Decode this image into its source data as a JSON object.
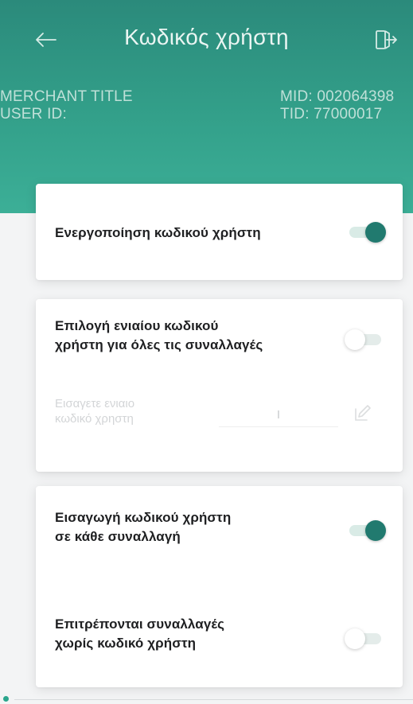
{
  "header": {
    "title": "Κωδικός χρήστη",
    "merchant_title_label": "MERCHANT TITLE",
    "user_id_label": "USER ID:",
    "mid": "MID: 002064398",
    "tid": "TID: 77000017",
    "back_icon": "arrow-left-icon",
    "logout_icon": "logout-icon"
  },
  "card1": {
    "enable_label": "Ενεργοποίηση κωδικού χρήστη",
    "enable_toggle": true
  },
  "card2": {
    "single_pin_label_line1": "Επιλογή ενιαίου κωδικού",
    "single_pin_label_line2": "χρήστη για όλες τις συναλλαγές",
    "single_pin_toggle": false,
    "pin_placeholder_line1": "Εισαγετε ενιαιο",
    "pin_placeholder_line2": "κωδικό χρηστη",
    "pin_value": "I",
    "edit_icon": "pencil-edit-icon"
  },
  "card3": {
    "each_tx_label_line1": "Εισαγωγή κωδικού χρήστη",
    "each_tx_label_line2": "σε κάθε συναλλαγή",
    "each_tx_toggle": true,
    "allow_without_label_line1": "Επιτρέπονται συναλλαγές",
    "allow_without_label_line2": "χωρίς κωδικό χρήστη",
    "allow_without_toggle": false
  },
  "colors": {
    "header_top": "#2b8a7b",
    "header_bottom": "#3caf97",
    "toggle_on": "#217a6f"
  }
}
